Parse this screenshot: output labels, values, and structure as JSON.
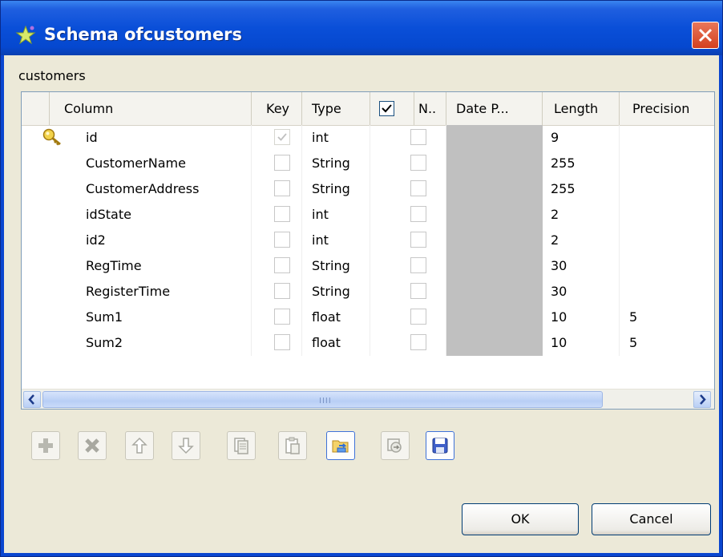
{
  "window": {
    "title": "Schema ofcustomers"
  },
  "schema_name": "customers",
  "table": {
    "columns": [
      {
        "label": "Column"
      },
      {
        "label": "Key"
      },
      {
        "label": "Type"
      },
      {
        "label": "N.."
      },
      {
        "label": "Date P..."
      },
      {
        "label": "Length"
      },
      {
        "label": "Precision"
      }
    ],
    "header_nullable_checked": true,
    "rows": [
      {
        "column": "id",
        "key": true,
        "key_disabled": true,
        "type": "int",
        "nullable": false,
        "length": "9",
        "precision": "",
        "is_key_row": true
      },
      {
        "column": "CustomerName",
        "key": false,
        "type": "String",
        "nullable": false,
        "length": "255",
        "precision": ""
      },
      {
        "column": "CustomerAddress",
        "key": false,
        "type": "String",
        "nullable": false,
        "length": "255",
        "precision": ""
      },
      {
        "column": "idState",
        "key": false,
        "type": "int",
        "nullable": false,
        "length": "2",
        "precision": ""
      },
      {
        "column": "id2",
        "key": false,
        "type": "int",
        "nullable": false,
        "length": "2",
        "precision": ""
      },
      {
        "column": "RegTime",
        "key": false,
        "type": "String",
        "nullable": false,
        "length": "30",
        "precision": ""
      },
      {
        "column": "RegisterTime",
        "key": false,
        "type": "String",
        "nullable": false,
        "length": "30",
        "precision": ""
      },
      {
        "column": "Sum1",
        "key": false,
        "type": "float",
        "nullable": false,
        "length": "10",
        "precision": "5"
      },
      {
        "column": "Sum2",
        "key": false,
        "type": "float",
        "nullable": false,
        "length": "10",
        "precision": "5"
      }
    ]
  },
  "toolbar": {
    "buttons": [
      "add-icon",
      "delete-icon",
      "move-up-icon",
      "move-down-icon",
      "copy-icon",
      "paste-icon",
      "import-icon",
      "export-icon",
      "save-icon"
    ]
  },
  "buttons": {
    "ok": "OK",
    "cancel": "Cancel"
  },
  "colors": {
    "title_bar": "#0a4fd8",
    "dialog_bg": "#ece9d8",
    "close": "#d4401f",
    "date_cell": "#c0c0c0"
  }
}
